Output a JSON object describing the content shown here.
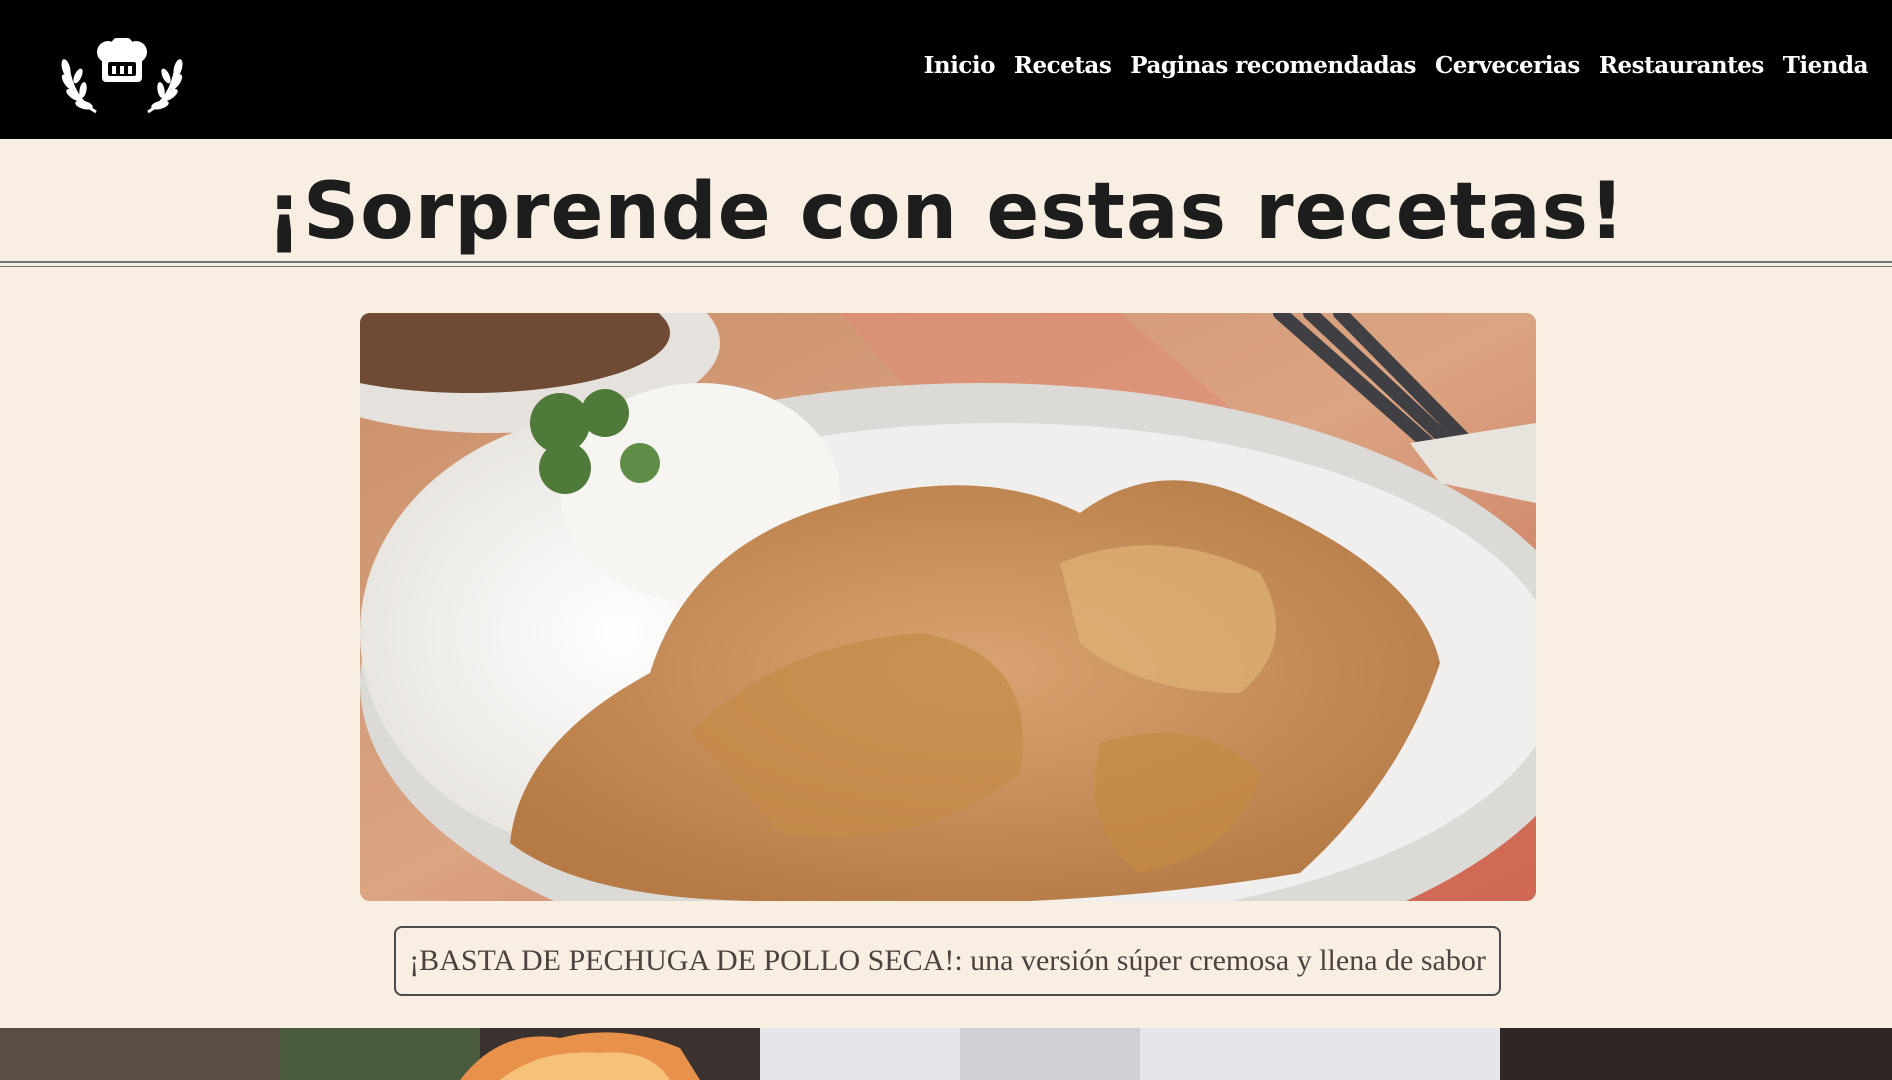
{
  "header": {
    "logo_icon": "chef-hat-laurel-icon",
    "nav": [
      {
        "label": "Inicio"
      },
      {
        "label": "Recetas"
      },
      {
        "label": "Paginas recomendadas"
      },
      {
        "label": "Cervecerias"
      },
      {
        "label": "Restaurantes"
      },
      {
        "label": "Tienda"
      }
    ]
  },
  "main": {
    "title": "¡Sorprende con estas recetas!",
    "featured": {
      "image_icon": "chicken-cream-sauce-rice-photo",
      "caption": "¡BASTA DE PECHUGA DE POLLO SECA!: una versión súper cremosa y llena de sabor"
    },
    "banner_image_icon": "chef-flame-kitchen-photo"
  },
  "colors": {
    "header_bg": "#000000",
    "page_bg": "#f8eee2",
    "title_text": "#1d1d1d",
    "caption_text": "#4b4340",
    "rule": "#6b7a78"
  }
}
